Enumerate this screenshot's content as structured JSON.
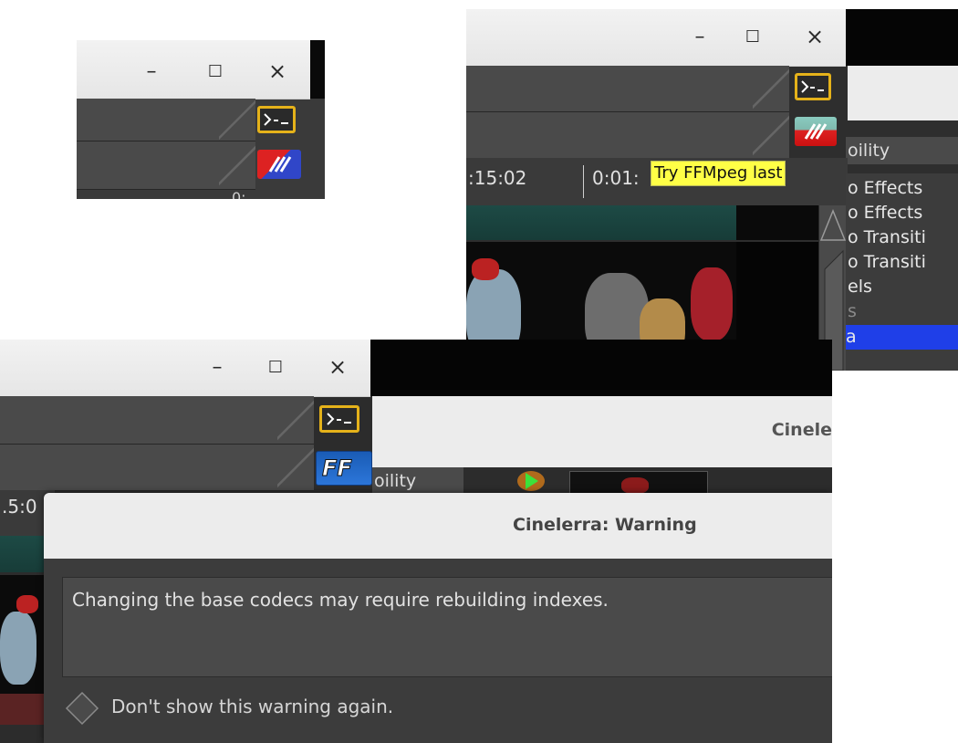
{
  "window_controls": {
    "minimize": "–",
    "maximize": "☐",
    "close": "×"
  },
  "panel1": {
    "partial_text": "0:"
  },
  "panel2": {
    "tab_partial": "oility",
    "timecode_a": ":15:02",
    "timecode_b": "0:01:",
    "tooltip": "Try FFMpeg last",
    "menu_items": [
      "o Effects",
      "o Effects",
      "o Transiti",
      "o Transiti",
      "els",
      "s",
      "a"
    ]
  },
  "panel3": {
    "header_title": "Cinele",
    "tab_partial": "oility",
    "timecode_partial": ".5:0"
  },
  "dialog": {
    "title": "Cinelerra: Warning",
    "message": "Changing the base codecs may require rebuilding indexes.",
    "checkbox_label": "Don't show this warning again."
  },
  "colors": {
    "accent_yellow": "#ffff46",
    "menu_selected": "#1f3fe8",
    "titlebar": "#ececec",
    "dark_panel": "#3b3b3b"
  }
}
